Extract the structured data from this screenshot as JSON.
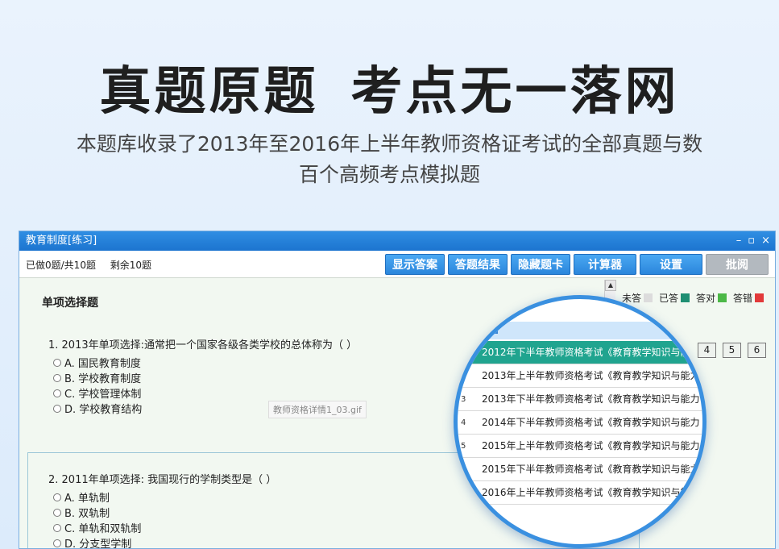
{
  "headline": {
    "part1": "真题原题",
    "part2": "考点无一落网"
  },
  "subtitle": {
    "line1": "本题库收录了2013年至2016年上半年教师资格证考试的全部真题与数",
    "line2": "百个高频考点模拟题"
  },
  "window": {
    "title": "教育制度[练习]",
    "controls": {
      "minimize": "–",
      "maximize": "▫",
      "close": "×"
    },
    "progress": {
      "done": "已做0题/共10题",
      "remaining": "剩余10题"
    },
    "buttons": [
      "显示答案",
      "答题结果",
      "隐藏题卡",
      "计算器",
      "设置",
      "批阅"
    ],
    "section_title": "单项选择题",
    "questions": [
      {
        "stem": "1. 2013年单项选择:通常把一个国家各级各类学校的总体称为（ ）",
        "options": [
          "A. 国民教育制度",
          "B. 学校教育制度",
          "C. 学校管理体制",
          "D. 学校教育结构"
        ]
      },
      {
        "stem": "2. 2011年单项选择: 我国现行的学制类型是（ ）",
        "options": [
          "A. 单轨制",
          "B. 双轨制",
          "C. 单轨和双轨制",
          "D. 分支型学制"
        ]
      }
    ],
    "image_label": "教师资格详情1_03.gif",
    "legend": {
      "unanswered": "未答",
      "answered": "已答",
      "correct": "答对",
      "wrong": "答错"
    },
    "legend_colors": {
      "unanswered": "#dcdcdc",
      "answered": "#1f8f73",
      "correct": "#4cb847",
      "wrong": "#e23a3a"
    },
    "question_numbers": [
      "4",
      "5",
      "6"
    ]
  },
  "magnifier": {
    "rows": [
      {
        "idx": "",
        "text": "2012年下半年教师资格考试《教育教学知识与能",
        "selected": true
      },
      {
        "idx": "",
        "text": "2013年上半年教师资格考试《教育教学知识与能力",
        "selected": false
      },
      {
        "idx": "3",
        "text": "2013年下半年教师资格考试《教育教学知识与能力",
        "selected": false
      },
      {
        "idx": "4",
        "text": "2014年下半年教师资格考试《教育教学知识与能力",
        "selected": false
      },
      {
        "idx": "5",
        "text": "2015年上半年教师资格考试《教育教学知识与能力",
        "selected": false
      },
      {
        "idx": "",
        "text": "2015年下半年教师资格考试《教育教学知识与能力",
        "selected": false
      },
      {
        "idx": "",
        "text": "2016年上半年教师资格考试《教育教学知识与能",
        "selected": false
      }
    ]
  }
}
